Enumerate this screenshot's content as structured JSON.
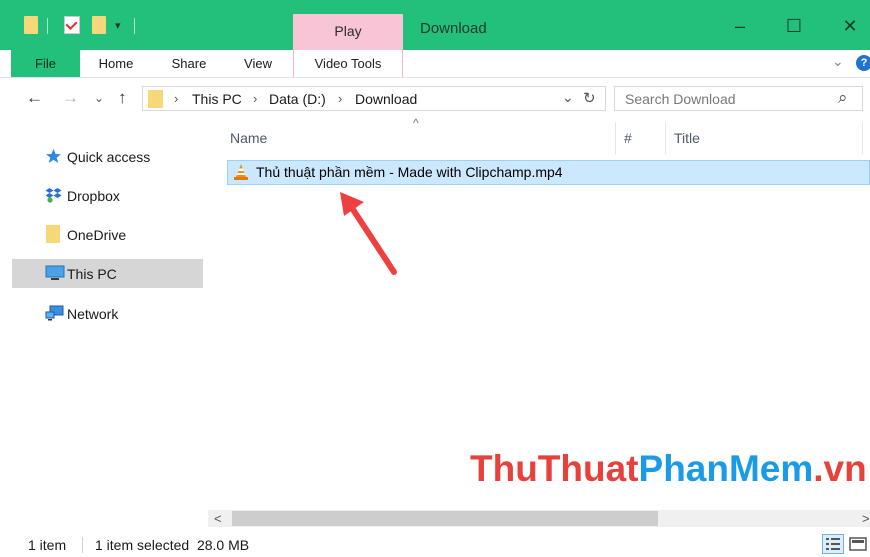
{
  "window": {
    "title": "Download",
    "contextual_tab": "Play",
    "buttons": {
      "minimize": "–",
      "maximize": "☐",
      "close": "✕"
    }
  },
  "ribbon": {
    "tabs": [
      "File",
      "Home",
      "Share",
      "View",
      "Video Tools"
    ],
    "expand_glyph": "⌄",
    "help_glyph": "?"
  },
  "address": {
    "crumbs": [
      "This PC",
      "Data (D:)",
      "Download"
    ],
    "separator": "›",
    "back": "←",
    "forward": "→",
    "recent": "⌄",
    "up": "↑",
    "dropdown": "⌄",
    "refresh": "↻"
  },
  "search": {
    "placeholder": "Search Download",
    "icon": "⌕"
  },
  "sidebar": {
    "items": [
      {
        "label": "Quick access",
        "icon": "star-icon"
      },
      {
        "label": "Dropbox",
        "icon": "dropbox-icon"
      },
      {
        "label": "OneDrive",
        "icon": "folder-icon"
      },
      {
        "label": "This PC",
        "icon": "computer-icon"
      },
      {
        "label": "Network",
        "icon": "network-icon"
      }
    ]
  },
  "columns": {
    "name": "Name",
    "number": "#",
    "title": "Title",
    "sort_glyph": "^"
  },
  "files": [
    {
      "name": "Thủ thuật phần mềm - Made with Clipchamp.mp4",
      "icon": "vlc-cone-icon"
    }
  ],
  "watermark": {
    "part1": "ThuThuat",
    "part2": "PhanMem",
    "part3": ".vn",
    "color1": "#e8413b",
    "color2": "#1a9be6"
  },
  "scrollbar": {
    "left": "<",
    "right": ">"
  },
  "status": {
    "count": "1 item",
    "selection": "1 item selected  28.0 MB"
  },
  "colors": {
    "accent": "#23c07c",
    "contextual": "#f7c5d6",
    "selection": "#cce8ff",
    "arrow": "#ee4040"
  }
}
